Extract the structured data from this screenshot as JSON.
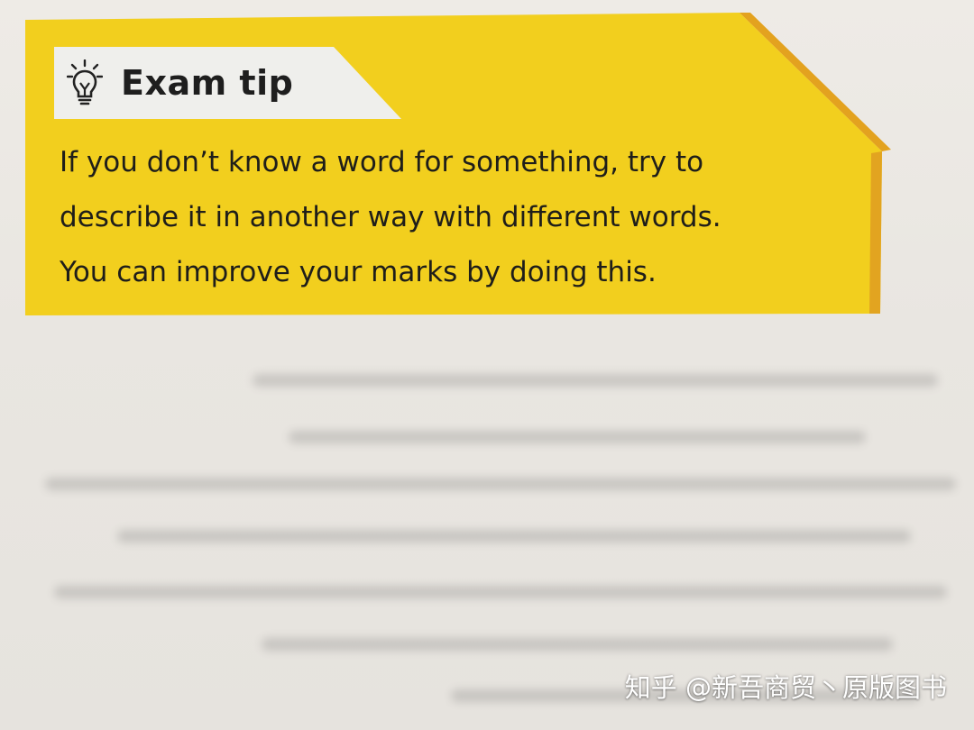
{
  "exam_tip": {
    "title": "Exam tip",
    "icon": "lightbulb-icon",
    "body_lines": [
      "If you don’t know a word for something, try to",
      "describe it in another way with different words.",
      "You can improve your marks by doing this."
    ]
  },
  "watermark": "知乎 @新吾商贸丶原版图书",
  "colors": {
    "box_yellow": "#f2cf1e",
    "box_edge_orange": "#e3a21f",
    "header_band": "#efefec",
    "text": "#1f1e1a",
    "page": "#ebe8e3"
  }
}
